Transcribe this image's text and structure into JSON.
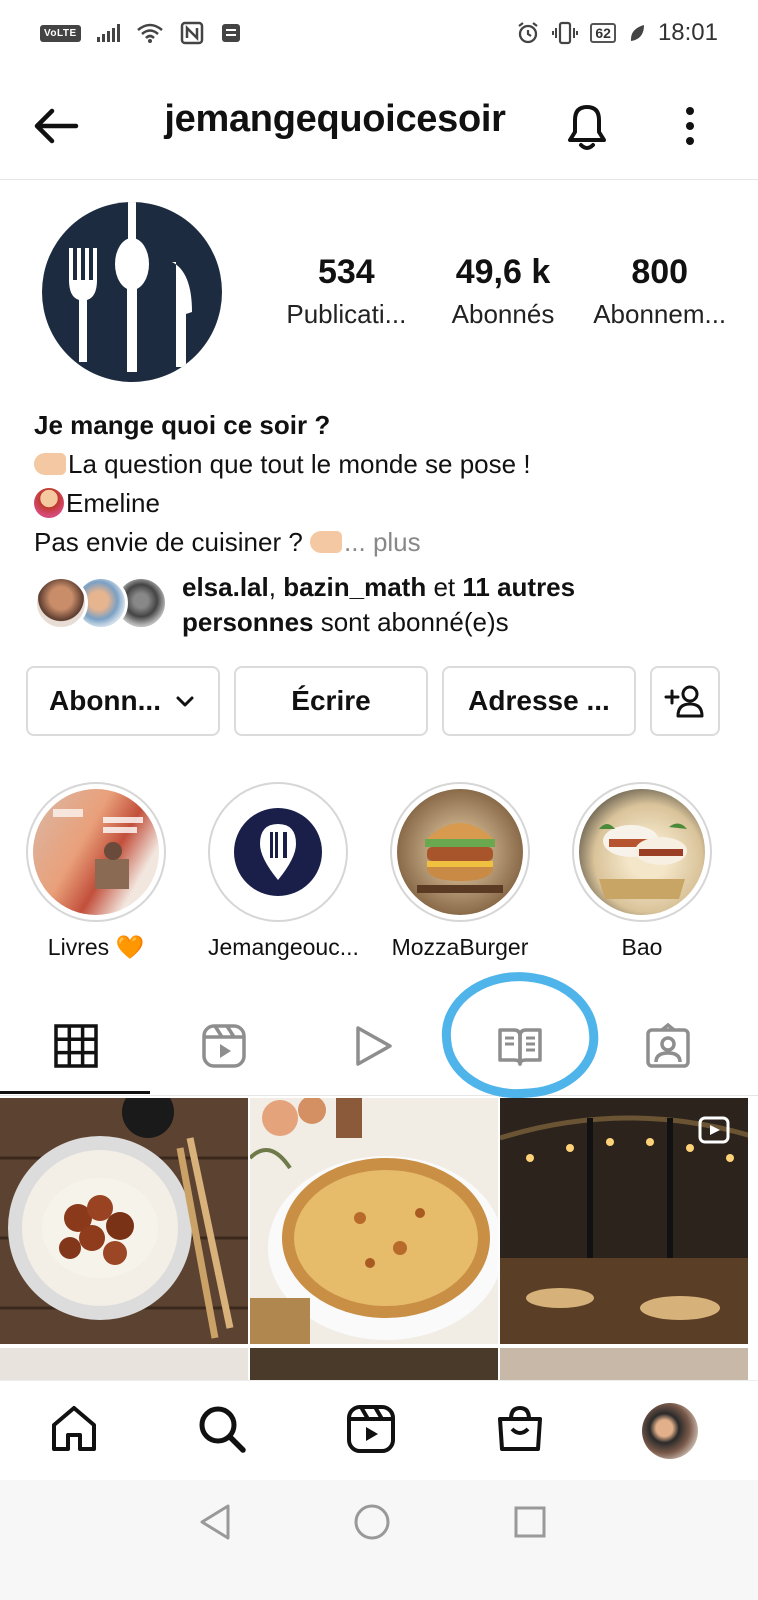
{
  "status_bar": {
    "left_badge": "VoLTE",
    "battery": "62",
    "time": "18:01"
  },
  "header": {
    "username": "jemangequoicesoir"
  },
  "stats": [
    {
      "value": "534",
      "label": "Publicati..."
    },
    {
      "value": "49,6 k",
      "label": "Abonnés"
    },
    {
      "value": "800",
      "label": "Abonnem..."
    }
  ],
  "bio": {
    "name": "Je mange quoi ce soir ?",
    "line1": "La question que tout le monde se pose !",
    "line2": "Emeline",
    "line3": "Pas envie de cuisiner ? ",
    "more": "... plus"
  },
  "followed_by": {
    "user1": "elsa.lal",
    "sep": ", ",
    "user2": "bazin_math",
    "and": " et ",
    "others": "11 autres",
    "persons": "personnes",
    "suffix": " sont abonné(e)s"
  },
  "buttons": {
    "following": "Abonn...",
    "message": "Écrire",
    "address": "Adresse ..."
  },
  "highlights": [
    {
      "label": "Livres 🧡"
    },
    {
      "label": "Jemangeouc..."
    },
    {
      "label": "MozzaBurger"
    },
    {
      "label": "Bao"
    }
  ],
  "tabs": [
    "grid-icon",
    "reels-icon",
    "video-icon",
    "guides-icon",
    "tagged-icon"
  ],
  "colors": {
    "annotation_circle": "#4fb4ea",
    "avatar_bg": "#1d2b40"
  }
}
